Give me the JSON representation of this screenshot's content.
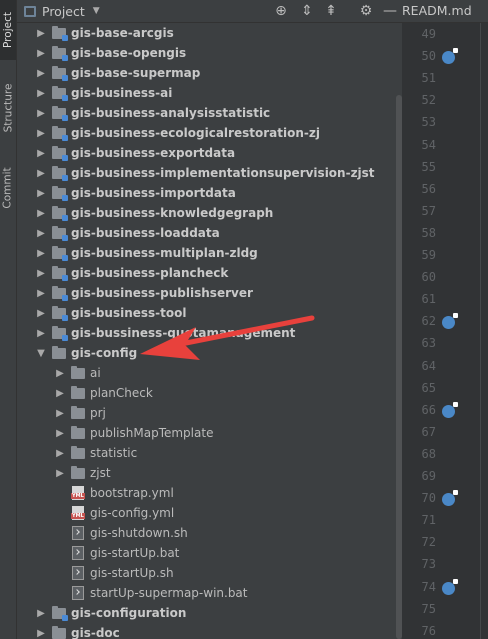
{
  "left_tabs": [
    "Project",
    "Structure",
    "Commit"
  ],
  "header": {
    "title": "Project"
  },
  "editor_tab": {
    "title": "READM.md"
  },
  "tree": [
    {
      "label": "gis-base-arcgis",
      "kind": "module",
      "arrow": "▶",
      "depth": 0
    },
    {
      "label": "gis-base-opengis",
      "kind": "module",
      "arrow": "▶",
      "depth": 0
    },
    {
      "label": "gis-base-supermap",
      "kind": "module",
      "arrow": "▶",
      "depth": 0
    },
    {
      "label": "gis-business-ai",
      "kind": "module",
      "arrow": "▶",
      "depth": 0
    },
    {
      "label": "gis-business-analysisstatistic",
      "kind": "module",
      "arrow": "▶",
      "depth": 0
    },
    {
      "label": "gis-business-ecologicalrestoration-zj",
      "kind": "module",
      "arrow": "▶",
      "depth": 0
    },
    {
      "label": "gis-business-exportdata",
      "kind": "module",
      "arrow": "▶",
      "depth": 0
    },
    {
      "label": "gis-business-implementationsupervision-zjst",
      "kind": "module",
      "arrow": "▶",
      "depth": 0
    },
    {
      "label": "gis-business-importdata",
      "kind": "module",
      "arrow": "▶",
      "depth": 0
    },
    {
      "label": "gis-business-knowledgegraph",
      "kind": "module",
      "arrow": "▶",
      "depth": 0
    },
    {
      "label": "gis-business-loaddata",
      "kind": "module",
      "arrow": "▶",
      "depth": 0
    },
    {
      "label": "gis-business-multiplan-zldg",
      "kind": "module",
      "arrow": "▶",
      "depth": 0
    },
    {
      "label": "gis-business-plancheck",
      "kind": "module",
      "arrow": "▶",
      "depth": 0
    },
    {
      "label": "gis-business-publishserver",
      "kind": "module",
      "arrow": "▶",
      "depth": 0
    },
    {
      "label": "gis-business-tool",
      "kind": "module",
      "arrow": "▶",
      "depth": 0
    },
    {
      "label": "gis-bussiness-quotamanagement",
      "kind": "module",
      "arrow": "▶",
      "depth": 0
    },
    {
      "label": "gis-config",
      "kind": "folder",
      "arrow": "▼",
      "depth": 0
    },
    {
      "label": "ai",
      "kind": "folder",
      "arrow": "▶",
      "depth": 1
    },
    {
      "label": "planCheck",
      "kind": "folder",
      "arrow": "▶",
      "depth": 1
    },
    {
      "label": "prj",
      "kind": "folder",
      "arrow": "▶",
      "depth": 1
    },
    {
      "label": "publishMapTemplate",
      "kind": "folder",
      "arrow": "▶",
      "depth": 1
    },
    {
      "label": "statistic",
      "kind": "folder",
      "arrow": "▶",
      "depth": 1
    },
    {
      "label": "zjst",
      "kind": "folder",
      "arrow": "▶",
      "depth": 1
    },
    {
      "label": "bootstrap.yml",
      "kind": "yml",
      "arrow": "",
      "depth": 1
    },
    {
      "label": "gis-config.yml",
      "kind": "yml",
      "arrow": "",
      "depth": 1
    },
    {
      "label": "gis-shutdown.sh",
      "kind": "sh",
      "arrow": "",
      "depth": 1
    },
    {
      "label": "gis-startUp.bat",
      "kind": "sh",
      "arrow": "",
      "depth": 1
    },
    {
      "label": "gis-startUp.sh",
      "kind": "sh",
      "arrow": "",
      "depth": 1
    },
    {
      "label": "startUp-supermap-win.bat",
      "kind": "sh",
      "arrow": "",
      "depth": 1
    },
    {
      "label": "gis-configuration",
      "kind": "module",
      "arrow": "▶",
      "depth": 0
    },
    {
      "label": "gis-doc",
      "kind": "folder",
      "arrow": "▶",
      "depth": 0
    }
  ],
  "gutter": {
    "lines": [
      "49",
      "50",
      "51",
      "52",
      "53",
      "54",
      "55",
      "56",
      "57",
      "58",
      "59",
      "60",
      "61",
      "62",
      "63",
      "64",
      "65",
      "66",
      "67",
      "68",
      "69",
      "70",
      "71",
      "72",
      "73",
      "74",
      "75",
      "76"
    ],
    "marked_lines": [
      "50",
      "62",
      "66",
      "70",
      "74"
    ]
  },
  "colors": {
    "background": "#3c3f41",
    "gutter": "#313335",
    "annotation_arrow": "#e8413c",
    "gutter_marker": "#4a88c7"
  }
}
